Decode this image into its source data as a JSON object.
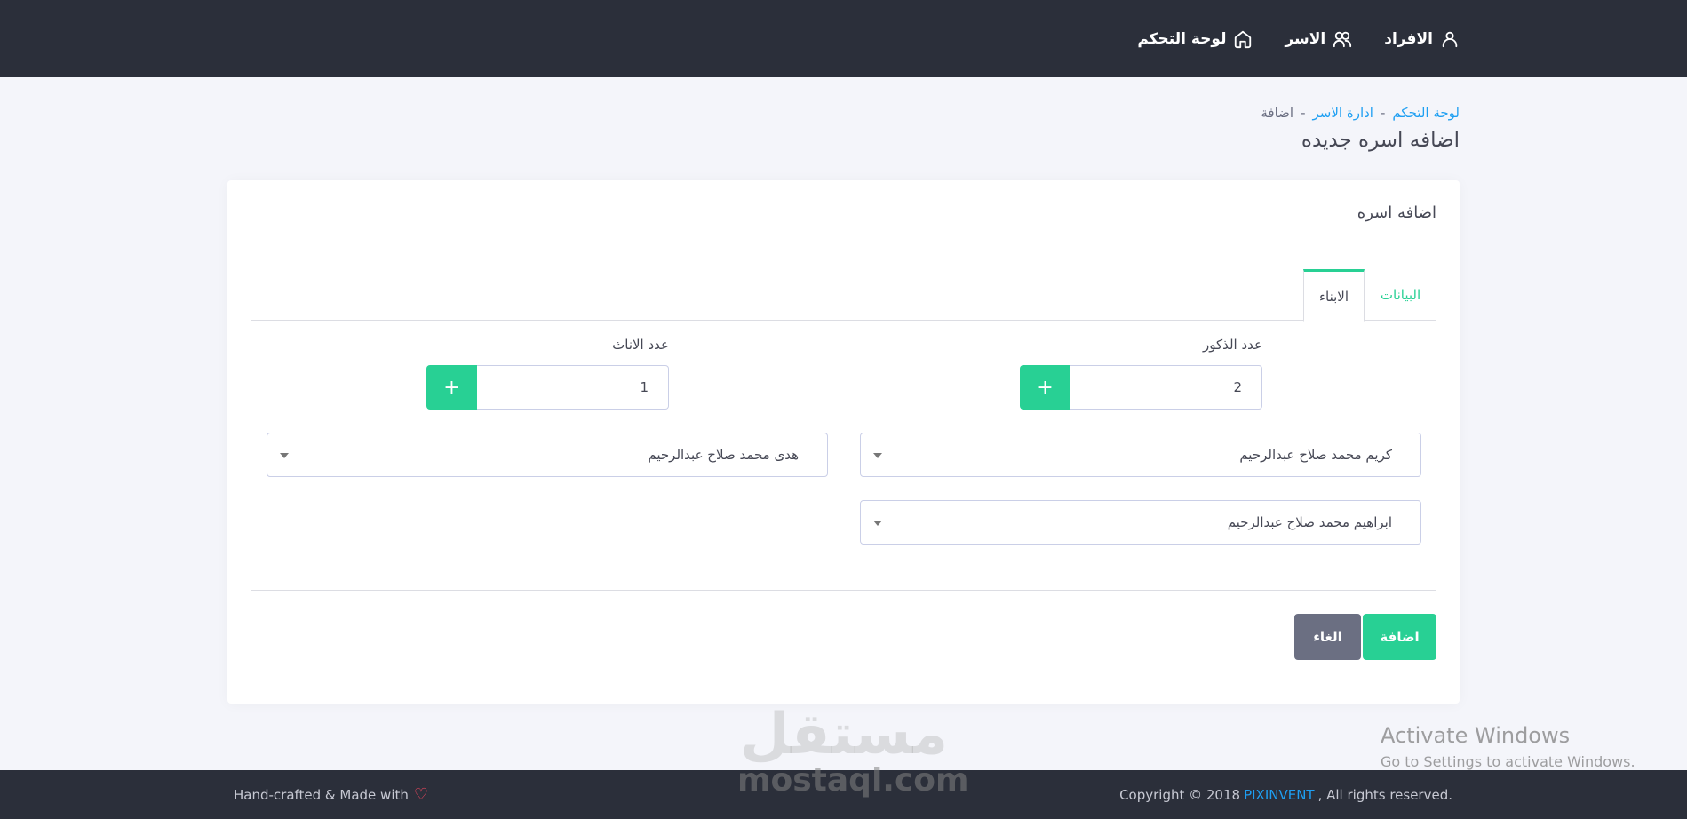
{
  "navbar": {
    "items": [
      {
        "label": "لوحة التحكم",
        "icon": "home-icon"
      },
      {
        "label": "الاسر",
        "icon": "users-icon"
      },
      {
        "label": "الافراد",
        "icon": "user-icon"
      }
    ]
  },
  "breadcrumb": {
    "items": [
      "لوحة التحكم",
      "ادارة الاسر"
    ],
    "separator": "-",
    "current": "اضافة"
  },
  "page": {
    "title": "اضافه اسره جديده"
  },
  "card": {
    "title": "اضافه اسره",
    "tabs": [
      {
        "label": "البيانات",
        "active": false
      },
      {
        "label": "الابناء",
        "active": true
      }
    ],
    "males": {
      "label": "عدد الذكور",
      "count": "2",
      "plus": "+",
      "selects": [
        "كريم محمد صلاح عبدالرحيم",
        "ابراهيم محمد صلاح عبدالرحيم"
      ]
    },
    "females": {
      "label": "عدد الاناث",
      "count": "1",
      "plus": "+",
      "selects": [
        "هدى محمد صلاح عبدالرحيم"
      ]
    },
    "buttons": {
      "add": "اضافة",
      "cancel": "الغاء"
    }
  },
  "footer": {
    "left_text": "Hand-crafted & Made with",
    "copyright_prefix": "Copyright © 2018",
    "brand": "PIXINVENT",
    "rights": ", All rights reserved."
  },
  "watermark": {
    "logo_text": "مستقل",
    "site": "mostaql.com",
    "activate_title": "Activate Windows",
    "activate_sub": "Go to Settings to activate Windows."
  },
  "colors": {
    "navbar": "#2b2f3a",
    "accent_green": "#28d094",
    "link_blue": "#1e9ff2",
    "cancel_gray": "#6b6f82",
    "heart": "#ff4961"
  }
}
